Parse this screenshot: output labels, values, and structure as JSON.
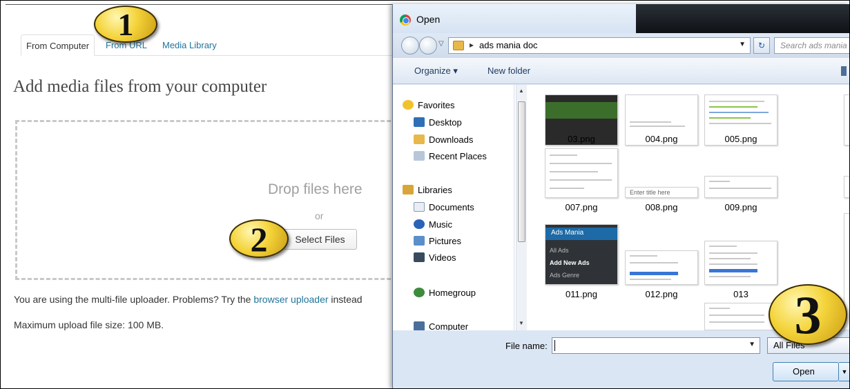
{
  "uploader": {
    "tabs": [
      {
        "label": "From Computer",
        "active": true
      },
      {
        "label": "From URL",
        "active": false
      },
      {
        "label": "Media Library",
        "active": false
      }
    ],
    "heading": "Add media files from your computer",
    "drop_title": "Drop files here",
    "drop_or": "or",
    "select_button": "Select Files",
    "note_prefix": "You are using the multi-file uploader. Problems? Try the ",
    "note_link": "browser uploader",
    "note_suffix": " instead",
    "max_size": "Maximum upload file size: 100 MB."
  },
  "callouts": [
    "1",
    "2",
    "3"
  ],
  "dialog": {
    "title": "Open",
    "address_path": "ads mania doc",
    "search_placeholder": "Search ads mania doc",
    "toolbar": {
      "organize": "Organize ▾",
      "new_folder": "New folder"
    },
    "nav": {
      "favorites": {
        "label": "Favorites",
        "items": [
          "Desktop",
          "Downloads",
          "Recent Places"
        ]
      },
      "libraries": {
        "label": "Libraries",
        "items": [
          "Documents",
          "Music",
          "Pictures",
          "Videos"
        ]
      },
      "homegroup": "Homegroup",
      "computer": "Computer"
    },
    "files": [
      "03.png",
      "004.png",
      "005.png",
      "007.png",
      "008.png",
      "009.png",
      "011.png",
      "012.png",
      "013"
    ],
    "thumb_text": {
      "ads_mania": "Ads Mania",
      "all_ads": "All Ads",
      "add_new_ads": "Add New Ads",
      "ads_genre": "Ads Genre",
      "enter_title": "Enter title here"
    },
    "file_name_label": "File name:",
    "file_name_value": "",
    "file_type": "All Files",
    "open_button": "Open"
  },
  "colors": {
    "wp_link": "#21759b",
    "dialog_bg": "#dbe6f4",
    "callout_gold": "#f4d33a"
  }
}
